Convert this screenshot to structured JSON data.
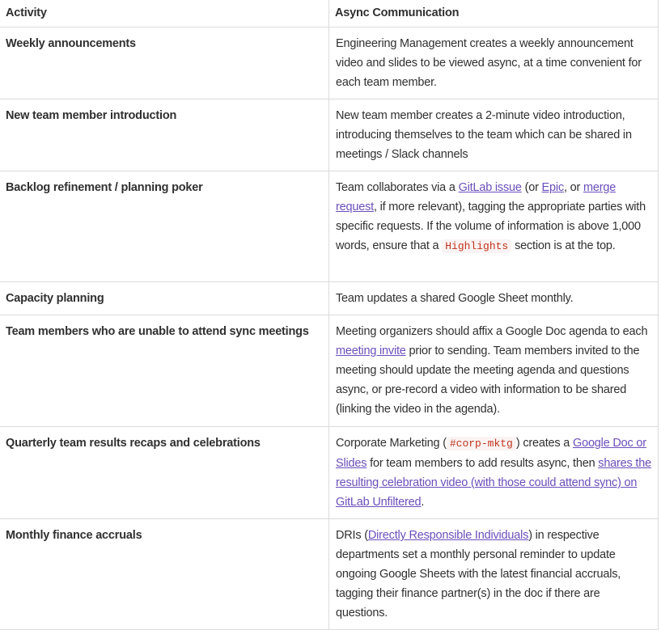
{
  "table": {
    "headers": [
      "Activity",
      "Async Communication"
    ],
    "rows": [
      {
        "activity": "Weekly announcements",
        "desc": {
          "t0": "Engineering Management creates a weekly announcement video and slides to be viewed async, at a time convenient for each team member."
        }
      },
      {
        "activity": "New team member introduction",
        "desc": {
          "t0": "New team member creates a 2-minute video introduction, introducing themselves to the team which can be shared in meetings / Slack channels"
        }
      },
      {
        "activity": "Backlog refinement / planning poker",
        "desc": {
          "t0": "Team collaborates via a ",
          "link1": "GitLab issue",
          "t1": " (or ",
          "link2": "Epic",
          "t2": ", or ",
          "link3": "merge request",
          "t3": ", if more relevant), tagging the appropriate parties with specific requests. If the volume of information is above 1,000 words, ensure that a ",
          "code": "Highlights",
          "t4": " section is at the top."
        }
      },
      {
        "activity": "Capacity planning",
        "desc": {
          "t0": "Team updates a shared Google Sheet monthly."
        }
      },
      {
        "activity": "Team members who are unable to attend sync meetings",
        "desc": {
          "t0": "Meeting organizers should affix a Google Doc agenda to each ",
          "link1": "meeting invite",
          "t1": " prior to sending. Team members invited to the meeting should update the meeting agenda and questions async, or pre-record a video with information to be shared (linking the video in the agenda)."
        }
      },
      {
        "activity": "Quarterly team results recaps and celebrations",
        "desc": {
          "t0": "Corporate Marketing (",
          "code": "#corp-mktg",
          "t1": ") creates a ",
          "link1": "Google Doc or Slides",
          "t2": " for team members to add results async, then ",
          "link2": "shares the resulting celebration video (with those could attend sync) on GitLab Unfiltered",
          "t3": "."
        }
      },
      {
        "activity": "Monthly finance accruals",
        "desc": {
          "t0": "DRIs (",
          "link1": "Directly Responsible Individuals",
          "t1": ") in respective departments set a monthly personal reminder to update ongoing Google Sheets with the latest financial accruals, tagging their finance partner(s) in the doc if there are questions."
        }
      }
    ]
  },
  "colors": {
    "link": "#6b4fbb",
    "code_text": "#c0341d",
    "code_bg": "#fbf3f3",
    "border": "#dbdbdb",
    "text": "#303030"
  }
}
